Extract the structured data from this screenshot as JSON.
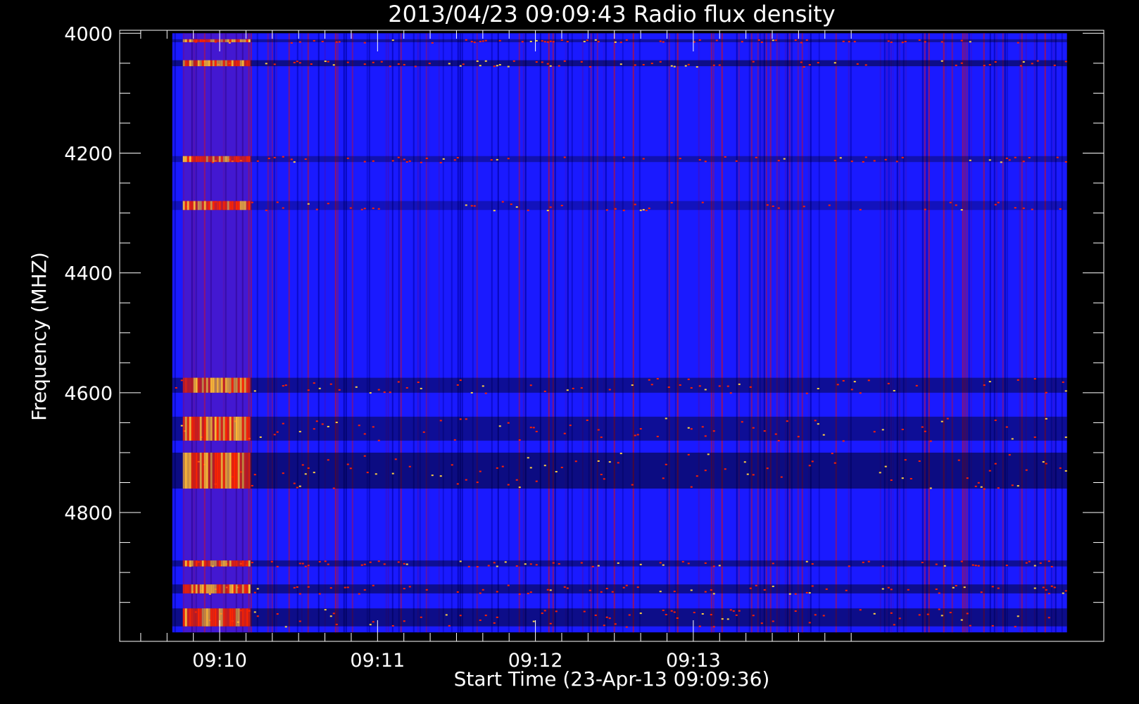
{
  "chart_data": {
    "type": "heatmap",
    "title": "2013/04/23 09:09:43 Radio flux density",
    "xlabel": "Start Time (23-Apr-13 09:09:36)",
    "ylabel": "Frequency (MHZ)",
    "x_range_seconds": [
      -14,
      360
    ],
    "data_x_range_seconds": [
      6,
      346
    ],
    "y_range_mhz": [
      3995,
      5015
    ],
    "data_y_range_mhz": [
      4000,
      5000
    ],
    "y_inverted": true,
    "y_ticks": [
      4000,
      4200,
      4400,
      4600,
      4800
    ],
    "y_minor_ticks": [
      4050,
      4100,
      4150,
      4250,
      4300,
      4350,
      4450,
      4500,
      4550,
      4650,
      4700,
      4750,
      4850,
      4900,
      4950
    ],
    "x_ticks": [
      {
        "label": "09:10",
        "seconds": 24
      },
      {
        "label": "09:11",
        "seconds": 84
      },
      {
        "label": "09:12",
        "seconds": 144
      },
      {
        "label": "09:13",
        "seconds": 204
      }
    ],
    "x_minor_ticks_seconds": [
      -6,
      4,
      14,
      34,
      44,
      54,
      64,
      74,
      94,
      104,
      114,
      124,
      134,
      154,
      164,
      174,
      184,
      194,
      214,
      224,
      234,
      244,
      254,
      264
    ],
    "colormap": [
      "#000000",
      "#2020ff",
      "#ff2000",
      "#ffff40"
    ],
    "background_color": "#1a1aff",
    "hot_bands_mhz": [
      {
        "from": 4010,
        "to": 4015,
        "level": 0.7
      },
      {
        "from": 4045,
        "to": 4055,
        "level": 0.9
      },
      {
        "from": 4205,
        "to": 4215,
        "level": 0.6
      },
      {
        "from": 4280,
        "to": 4295,
        "level": 0.5
      },
      {
        "from": 4575,
        "to": 4600,
        "level": 0.8
      },
      {
        "from": 4640,
        "to": 4680,
        "level": 0.8
      },
      {
        "from": 4700,
        "to": 4760,
        "level": 0.95
      },
      {
        "from": 4880,
        "to": 4890,
        "level": 0.8
      },
      {
        "from": 4920,
        "to": 4935,
        "level": 0.85
      },
      {
        "from": 4960,
        "to": 4990,
        "level": 0.9
      }
    ],
    "burst_interval_seconds": [
      10,
      35
    ]
  }
}
